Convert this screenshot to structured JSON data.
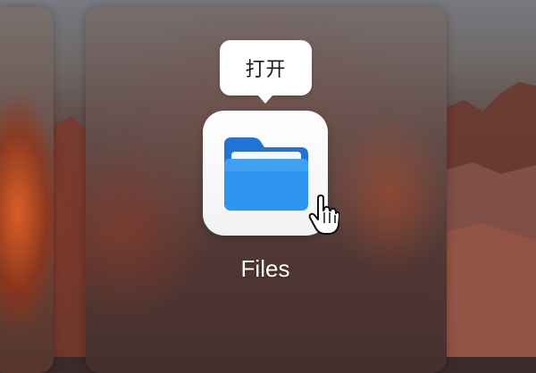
{
  "tooltip": {
    "text": "打开"
  },
  "app": {
    "label": "Files",
    "icon": "folder-icon"
  },
  "cursor": {
    "icon": "hand-pointer-icon"
  },
  "colors": {
    "folder_front": "#2f96ef",
    "folder_back": "#1f74d6",
    "tile_background": "#ffffff",
    "label_text": "#ffffff"
  }
}
